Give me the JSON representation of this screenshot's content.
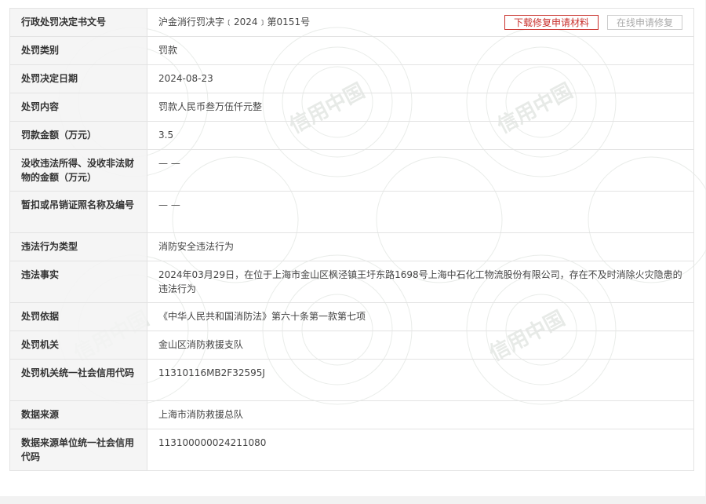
{
  "buttons": {
    "download": "下载修复申请材料",
    "online": "在线申请修复"
  },
  "watermark_text": "信用中国",
  "rows": [
    {
      "label": "行政处罚决定书文号",
      "value": "沪金消行罚决字﹝2024﹞第0151号"
    },
    {
      "label": "处罚类别",
      "value": "罚款"
    },
    {
      "label": "处罚决定日期",
      "value": "2024-08-23"
    },
    {
      "label": "处罚内容",
      "value": "罚款人民币叁万伍仟元整"
    },
    {
      "label": "罚款金额（万元）",
      "value": "3.5"
    },
    {
      "label": "没收违法所得、没收非法财物的金额（万元）",
      "value": "— —"
    },
    {
      "label": "暂扣或吊销证照名称及编号",
      "value": "— —"
    },
    {
      "label": "违法行为类型",
      "value": "消防安全违法行为"
    },
    {
      "label": "违法事实",
      "value": "2024年03月29日，在位于上海市金山区枫泾镇王圩东路1698号上海中石化工物流股份有限公司，存在不及时消除火灾隐患的违法行为"
    },
    {
      "label": "处罚依据",
      "value": "《中华人民共和国消防法》第六十条第一款第七项"
    },
    {
      "label": "处罚机关",
      "value": "金山区消防救援支队"
    },
    {
      "label": "处罚机关统一社会信用代码",
      "value": "11310116MB2F32595J"
    },
    {
      "label": "数据来源",
      "value": "上海市消防救援总队"
    },
    {
      "label": "数据来源单位统一社会信用代码",
      "value": "11310000002421108​0"
    }
  ]
}
